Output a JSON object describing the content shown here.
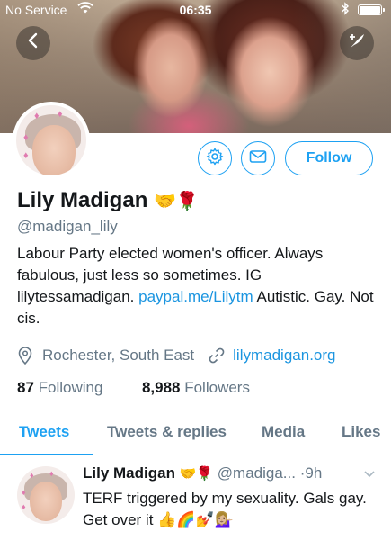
{
  "status_bar": {
    "carrier": "No Service",
    "time": "06:35",
    "wifi_icon": "wifi-icon",
    "bluetooth_icon": "bluetooth-icon",
    "battery_icon": "battery-icon"
  },
  "header": {
    "back_icon": "back-icon",
    "compose_icon": "compose-tweet-icon"
  },
  "actions": {
    "settings_icon": "gear-icon",
    "message_icon": "mail-icon",
    "follow_label": "Follow"
  },
  "profile": {
    "name": "Lily Madigan",
    "name_emoji": "🤝🌹",
    "handle": "@madigan_lily",
    "bio_text": "Labour Party elected women's officer. Always fabulous, just less so sometimes. IG lilytessamadigan.",
    "bio_link": "paypal.me/Lilytm",
    "bio_tail": "Autistic. Gay. Not cis.",
    "location": "Rochester, South East",
    "website": "lilymadigan.org",
    "following_count": "87",
    "following_label": "Following",
    "followers_count": "8,988",
    "followers_label": "Followers"
  },
  "tabs": [
    {
      "label": "Tweets",
      "active": true
    },
    {
      "label": "Tweets & replies",
      "active": false
    },
    {
      "label": "Media",
      "active": false
    },
    {
      "label": "Likes",
      "active": false
    }
  ],
  "tweet": {
    "name": "Lily Madigan",
    "name_emoji": "🤝🌹",
    "handle": "@madiga...",
    "separator": "·",
    "time": "9h",
    "text": "TERF triggered by my sexuality. Gals gay. Get over it",
    "text_emoji": "👍🌈💅💁🏼‍♀️"
  },
  "colors": {
    "accent": "#1da1f2",
    "link": "#1b95e0",
    "secondary_text": "#657786",
    "primary_text": "#14171a"
  }
}
